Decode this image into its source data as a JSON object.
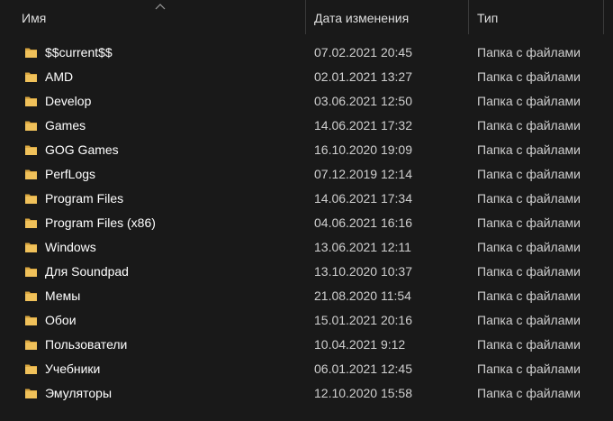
{
  "columns": {
    "name": "Имя",
    "date": "Дата изменения",
    "type": "Тип"
  },
  "colors": {
    "background": "#191919",
    "folder": "#f0c15a",
    "text": "#ffffff",
    "secondary_text": "#cfcfcf"
  },
  "icons": {
    "sort": "chevron-up-icon",
    "folder": "folder-icon"
  },
  "files": [
    {
      "name": "$$current$$",
      "date": "07.02.2021 20:45",
      "type": "Папка с файлами"
    },
    {
      "name": "AMD",
      "date": "02.01.2021 13:27",
      "type": "Папка с файлами"
    },
    {
      "name": "Develop",
      "date": "03.06.2021 12:50",
      "type": "Папка с файлами"
    },
    {
      "name": "Games",
      "date": "14.06.2021 17:32",
      "type": "Папка с файлами"
    },
    {
      "name": "GOG Games",
      "date": "16.10.2020 19:09",
      "type": "Папка с файлами"
    },
    {
      "name": "PerfLogs",
      "date": "07.12.2019 12:14",
      "type": "Папка с файлами"
    },
    {
      "name": "Program Files",
      "date": "14.06.2021 17:34",
      "type": "Папка с файлами"
    },
    {
      "name": "Program Files (x86)",
      "date": "04.06.2021 16:16",
      "type": "Папка с файлами"
    },
    {
      "name": "Windows",
      "date": "13.06.2021 12:11",
      "type": "Папка с файлами"
    },
    {
      "name": "Для Soundpad",
      "date": "13.10.2020 10:37",
      "type": "Папка с файлами"
    },
    {
      "name": "Мемы",
      "date": "21.08.2020 11:54",
      "type": "Папка с файлами"
    },
    {
      "name": "Обои",
      "date": "15.01.2021 20:16",
      "type": "Папка с файлами"
    },
    {
      "name": "Пользователи",
      "date": "10.04.2021 9:12",
      "type": "Папка с файлами"
    },
    {
      "name": "Учебники",
      "date": "06.01.2021 12:45",
      "type": "Папка с файлами"
    },
    {
      "name": "Эмуляторы",
      "date": "12.10.2020 15:58",
      "type": "Папка с файлами"
    }
  ]
}
